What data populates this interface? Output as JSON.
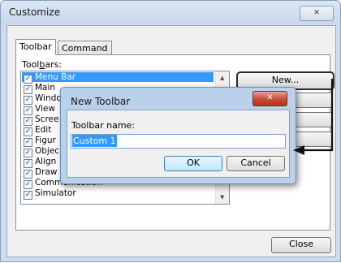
{
  "window": {
    "title": "Customize",
    "close_glyph": "✕"
  },
  "tabs": [
    {
      "label": "Toolbar"
    },
    {
      "label": "Command"
    }
  ],
  "toolbars_label_pre": "Tool",
  "toolbars_label_u": "b",
  "toolbars_label_post": "ars:",
  "toolbar_items": [
    {
      "label": "Menu Bar",
      "checked": true,
      "selected": true
    },
    {
      "label": "Main",
      "checked": true
    },
    {
      "label": "Windo",
      "checked": true
    },
    {
      "label": "View",
      "checked": true
    },
    {
      "label": "Scree",
      "checked": true
    },
    {
      "label": "Edit",
      "checked": true
    },
    {
      "label": "Figur",
      "checked": true
    },
    {
      "label": "Objec",
      "checked": true
    },
    {
      "label": "Align",
      "checked": true
    },
    {
      "label": "Draw",
      "checked": true
    },
    {
      "label": "Communication",
      "checked": true
    },
    {
      "label": "Simulator",
      "checked": true
    }
  ],
  "buttons": {
    "new_label": "New...",
    "close_label": "Close"
  },
  "dialog": {
    "title": "New Toolbar",
    "close_glyph": "✕",
    "field_label": "Toolbar name:",
    "field_value": "Custom 1",
    "ok_label": "OK",
    "cancel_label": "Cancel"
  },
  "colors": {
    "selection": "#3399ff",
    "dialog_frame": "#b9d1ea",
    "close_red": "#c74a36"
  }
}
